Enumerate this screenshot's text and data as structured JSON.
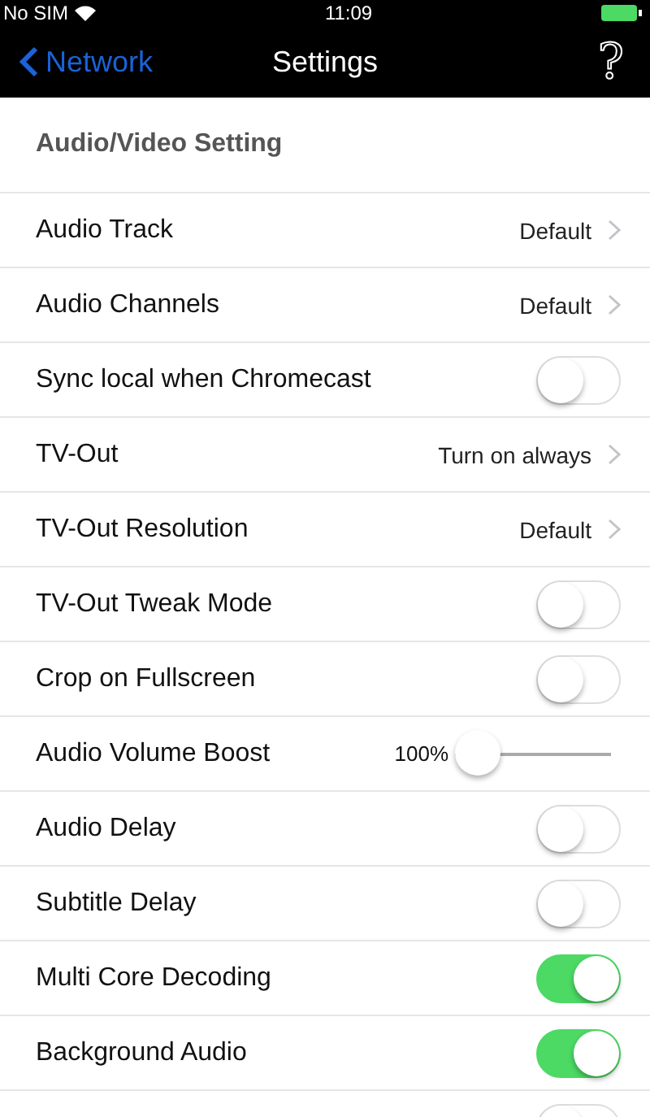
{
  "status_bar": {
    "carrier": "No SIM",
    "time": "11:09"
  },
  "nav": {
    "back": "Network",
    "title": "Settings",
    "help": "?"
  },
  "section": "Audio/Video Setting",
  "rows": [
    {
      "kind": "disclosure",
      "label": "Audio Track",
      "value": "Default"
    },
    {
      "kind": "disclosure",
      "label": "Audio Channels",
      "value": "Default"
    },
    {
      "kind": "toggle",
      "label": "Sync local when Chromecast",
      "on": false
    },
    {
      "kind": "disclosure",
      "label": "TV-Out",
      "value": "Turn on always"
    },
    {
      "kind": "disclosure",
      "label": "TV-Out Resolution",
      "value": "Default"
    },
    {
      "kind": "toggle",
      "label": "TV-Out Tweak Mode",
      "on": false
    },
    {
      "kind": "toggle",
      "label": "Crop on Fullscreen",
      "on": false
    },
    {
      "kind": "slider",
      "label": "Audio Volume Boost",
      "reading": "100%",
      "level": 0
    },
    {
      "kind": "toggle",
      "label": "Audio Delay",
      "on": false
    },
    {
      "kind": "toggle",
      "label": "Subtitle Delay",
      "on": false
    },
    {
      "kind": "toggle",
      "label": "Multi Core Decoding",
      "on": true
    },
    {
      "kind": "toggle",
      "label": "Background Audio",
      "on": true
    },
    {
      "kind": "toggle",
      "on": false
    }
  ]
}
